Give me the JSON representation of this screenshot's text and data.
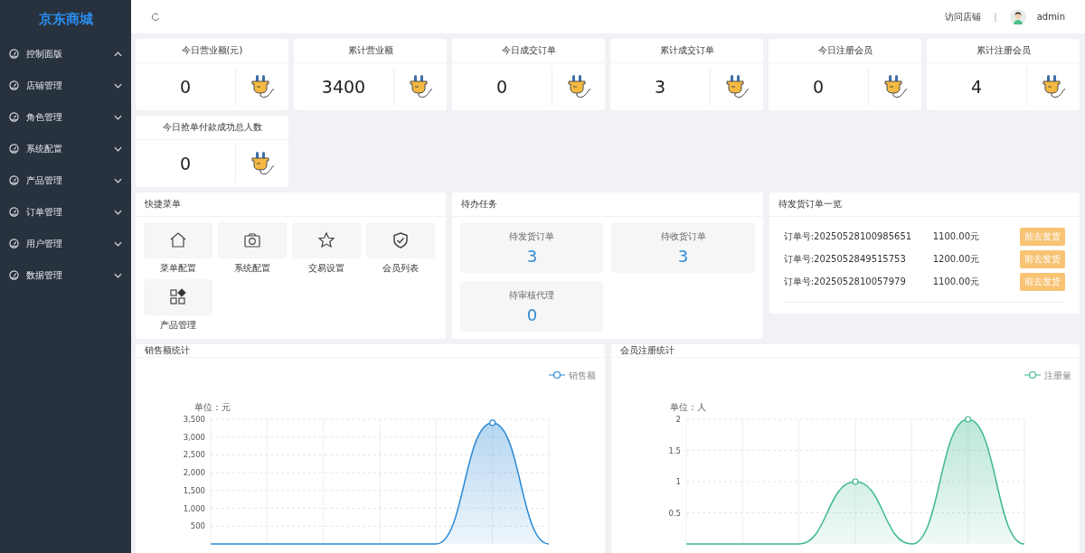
{
  "sidebar": {
    "brand": "京东商城",
    "items": [
      {
        "label": "控制面版",
        "expanded": true
      },
      {
        "label": "店铺管理",
        "expanded": false
      },
      {
        "label": "角色管理",
        "expanded": false
      },
      {
        "label": "系统配置",
        "expanded": false
      },
      {
        "label": "产品管理",
        "expanded": false
      },
      {
        "label": "订单管理",
        "expanded": false
      },
      {
        "label": "用户管理",
        "expanded": false
      },
      {
        "label": "数据管理",
        "expanded": false
      }
    ]
  },
  "topbar": {
    "visit_store": "访问店铺",
    "separator": "|",
    "user": "admin"
  },
  "stats": [
    {
      "title": "今日营业额(元)",
      "value": "0"
    },
    {
      "title": "累计营业额",
      "value": "3400"
    },
    {
      "title": "今日成交订单",
      "value": "0"
    },
    {
      "title": "累计成交订单",
      "value": "3"
    },
    {
      "title": "今日注册会员",
      "value": "0"
    },
    {
      "title": "累计注册会员",
      "value": "4"
    },
    {
      "title": "今日抢单付款成功总人数",
      "value": "0"
    }
  ],
  "quick_menu": {
    "title": "快捷菜单",
    "items": [
      {
        "label": "菜单配置"
      },
      {
        "label": "系统配置"
      },
      {
        "label": "交易设置"
      },
      {
        "label": "会员列表"
      },
      {
        "label": "产品管理"
      }
    ]
  },
  "tasks": {
    "title": "待办任务",
    "items": [
      {
        "label": "待发货订单",
        "count": "3"
      },
      {
        "label": "待收货订单",
        "count": "3"
      },
      {
        "label": "待审核代理",
        "count": "0"
      }
    ]
  },
  "orders": {
    "title": "待发货订单一览",
    "rows": [
      {
        "order_no": "订单号:20250528100985651",
        "amount": "1100.00元",
        "action": "前去发货"
      },
      {
        "order_no": "订单号:2025052849515753",
        "amount": "1200.00元",
        "action": "前去发货"
      },
      {
        "order_no": "订单号:2025052810057979",
        "amount": "1100.00元",
        "action": "前去发货"
      }
    ]
  },
  "charts": [
    {
      "title": "销售额统计",
      "chart_data": {
        "type": "area",
        "grid": true,
        "ylabel": "单位：元",
        "ylim": [
          0,
          3500
        ],
        "yticks": [
          {
            "value": 500,
            "label": "500"
          },
          {
            "value": 1000,
            "label": "1,000"
          },
          {
            "value": 1500,
            "label": "1,500"
          },
          {
            "value": 2000,
            "label": "2,000"
          },
          {
            "value": 2500,
            "label": "2,500"
          },
          {
            "value": 3000,
            "label": "3,000"
          },
          {
            "value": 3500,
            "label": "3,500"
          }
        ],
        "series": [
          {
            "name": "销售额",
            "color": "#2b8ad6",
            "values": [
              0,
              0,
              0,
              0,
              0,
              3400,
              0
            ]
          }
        ]
      }
    },
    {
      "title": "会员注册统计",
      "chart_data": {
        "type": "area",
        "grid": true,
        "ylabel": "单位：人",
        "ylim": [
          0,
          2
        ],
        "yticks": [
          0.5,
          1,
          {
            "value": 1.5,
            "label": "1.5"
          },
          2
        ],
        "series": [
          {
            "name": "注册量",
            "color": "#3db98e",
            "values": [
              0,
              0,
              0,
              1,
              0,
              2,
              0
            ]
          }
        ]
      }
    }
  ]
}
